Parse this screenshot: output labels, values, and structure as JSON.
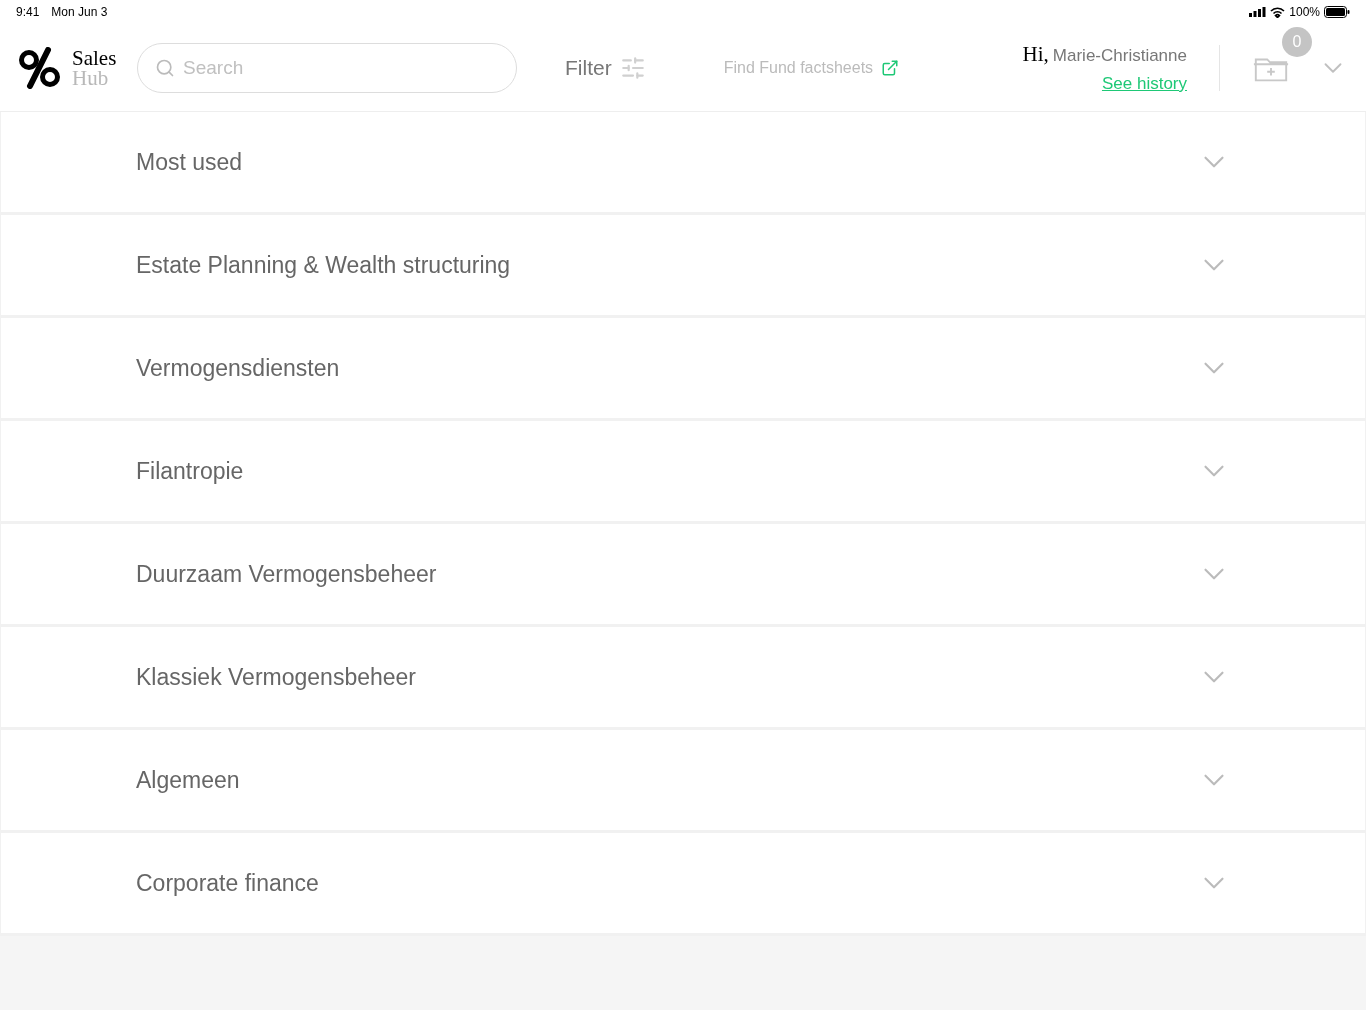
{
  "status_bar": {
    "time": "9:41",
    "date": "Mon Jun 3",
    "battery": "100%"
  },
  "logo": {
    "line_1": "Sales",
    "line_2": "Hub"
  },
  "search": {
    "placeholder": "Search"
  },
  "filter": {
    "label": "Filter"
  },
  "factsheets_link": {
    "label": "Find Fund factsheets"
  },
  "user": {
    "greeting": "Hi,",
    "name": "Marie-Christianne",
    "history_link": "See history"
  },
  "cart": {
    "count": "0"
  },
  "sections": [
    {
      "title": "Most used",
      "expanded": false
    },
    {
      "title": "Estate Planning & Wealth structuring",
      "expanded": false
    },
    {
      "title": "Vermogensdiensten",
      "expanded": false
    },
    {
      "title": "Filantropie",
      "expanded": false
    },
    {
      "title": "Duurzaam Vermogensbeheer",
      "expanded": false
    },
    {
      "title": "Klassiek Vermogensbeheer",
      "expanded": false
    },
    {
      "title": "Algemeen",
      "expanded": false
    },
    {
      "title": "Corporate finance",
      "expanded": false
    }
  ]
}
